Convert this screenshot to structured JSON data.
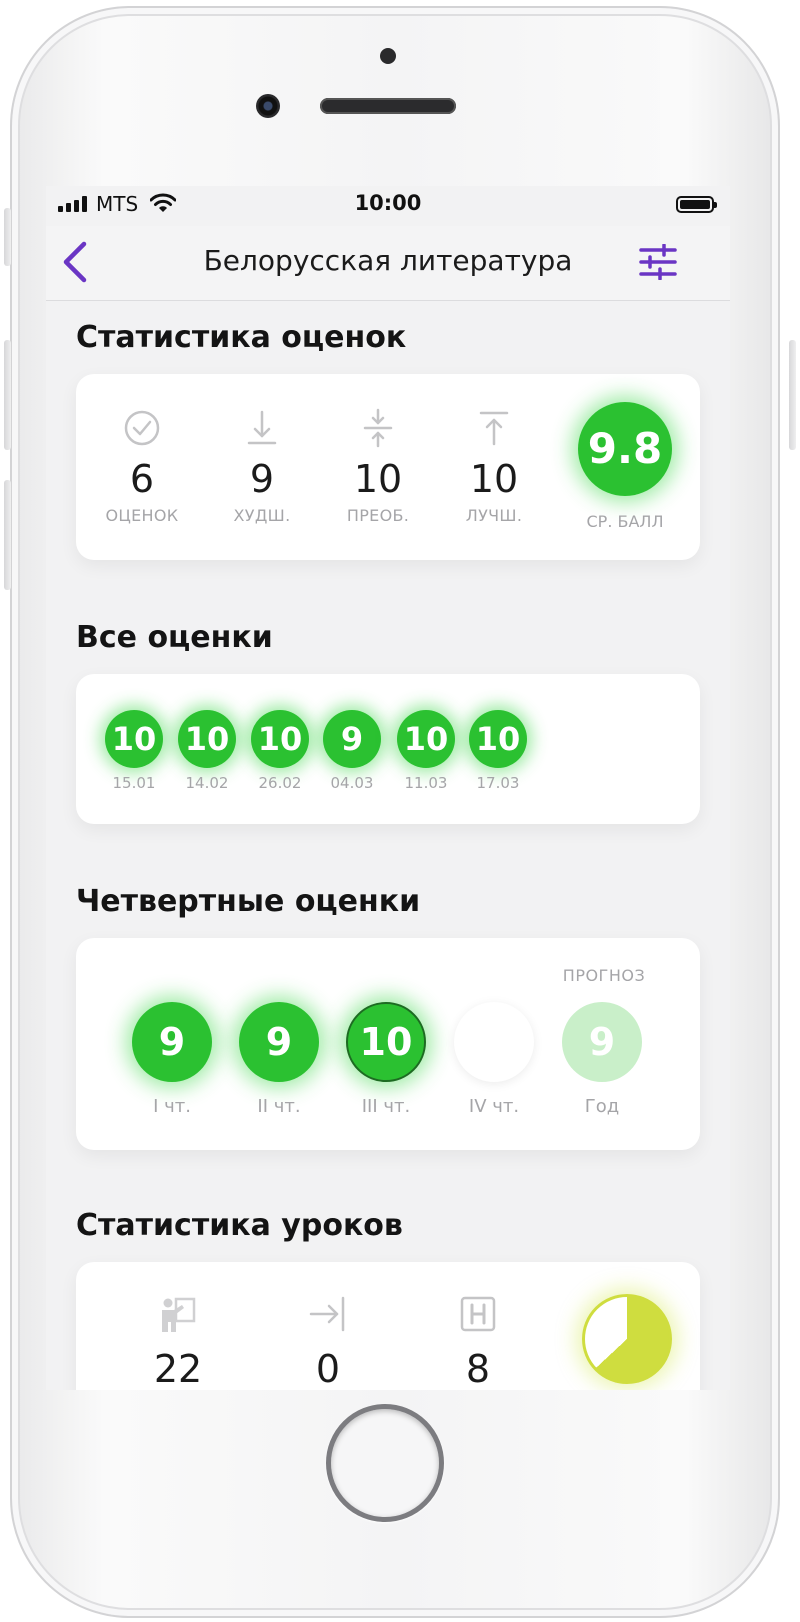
{
  "status": {
    "carrier": "MTS",
    "time": "10:00"
  },
  "nav": {
    "title": "Белорусская литература",
    "back_icon": "chevron-left-icon",
    "filter_icon": "sliders-icon",
    "accent_color": "#6a35c4"
  },
  "grade_stats": {
    "title": "Статистика оценок",
    "items": [
      {
        "icon": "check-circle-icon",
        "value": "6",
        "label": "ОЦЕНОК"
      },
      {
        "icon": "arrow-down-icon",
        "value": "9",
        "label": "ХУДШ."
      },
      {
        "icon": "compress-icon",
        "value": "10",
        "label": "ПРЕОБ."
      },
      {
        "icon": "arrow-up-icon",
        "value": "10",
        "label": "ЛУЧШ."
      }
    ],
    "average": {
      "value": "9.8",
      "label": "СР. БАЛЛ"
    }
  },
  "all_grades": {
    "title": "Все оценки",
    "items": [
      {
        "value": "10",
        "date": "15.01"
      },
      {
        "value": "10",
        "date": "14.02"
      },
      {
        "value": "10",
        "date": "26.02"
      },
      {
        "value": "9",
        "date": "04.03"
      },
      {
        "value": "10",
        "date": "11.03"
      },
      {
        "value": "10",
        "date": "17.03"
      }
    ]
  },
  "quarter_grades": {
    "title": "Четвертные оценки",
    "forecast_label": "ПРОГНОЗ",
    "items": [
      {
        "value": "9",
        "label": "I чт.",
        "state": "done"
      },
      {
        "value": "9",
        "label": "II чт.",
        "state": "done"
      },
      {
        "value": "10",
        "label": "III чт.",
        "state": "current"
      },
      {
        "value": "",
        "label": "IV чт.",
        "state": "empty"
      },
      {
        "value": "9",
        "label": "Год",
        "state": "forecast"
      }
    ]
  },
  "lesson_stats": {
    "title": "Статистика уроков",
    "items": [
      {
        "icon": "attended-lesson-icon",
        "value": "22"
      },
      {
        "icon": "late-arrow-icon",
        "value": "0"
      },
      {
        "icon": "absent-h-icon",
        "value": "8"
      }
    ],
    "attendance_fraction": 0.63,
    "pie_color": "#cfdd3f"
  },
  "colors": {
    "grade_green": "#2bc131",
    "forecast_green": "#c9efc9",
    "muted_text": "#a5a5a8"
  }
}
